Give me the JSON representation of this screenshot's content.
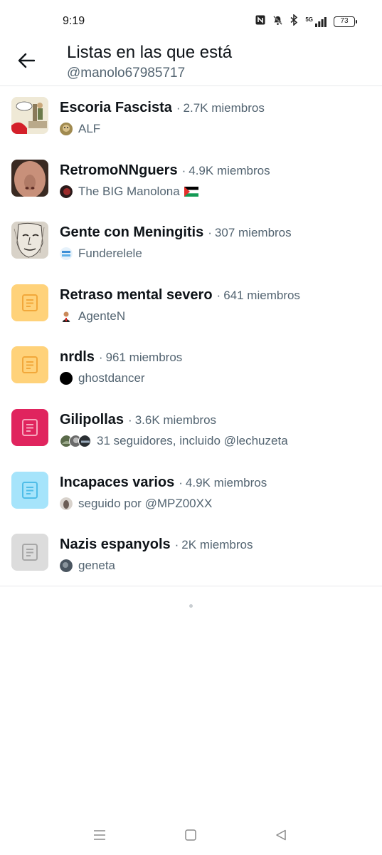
{
  "status_bar": {
    "time": "9:19",
    "network_label": "5G",
    "battery_level": "73"
  },
  "header": {
    "title": "Listas en las que está",
    "subtitle": "@manolo67985717"
  },
  "lists": [
    {
      "name": "Escoria Fascista",
      "members": "2.7K miembros",
      "owner": "ALF",
      "thumb_icon": "cartoon-image",
      "avatar_color": "#a08a50"
    },
    {
      "name": "RetromoNNguers",
      "members": "4.9K miembros",
      "owner": "The BIG Manolona",
      "thumb_icon": "face-photo",
      "avatar_color": "#7a1e1e"
    },
    {
      "name": "Gente con Meningitis",
      "members": "307 miembros",
      "owner": "Funderelele",
      "thumb_icon": "sketch-portrait",
      "avatar_color": "#3d8fd6"
    },
    {
      "name": "Retraso mental severo",
      "members": "641 miembros",
      "owner": "AgenteN",
      "thumb_icon": "list-icon",
      "thumb_color": "#ffd27a",
      "icon_color": "#f2a83a",
      "avatar_color": "#c98a5a"
    },
    {
      "name": "nrdls",
      "members": "961 miembros",
      "owner": "ghostdancer",
      "thumb_icon": "list-icon",
      "thumb_color": "#ffd27a",
      "icon_color": "#f2a83a",
      "avatar_color": "#000000"
    },
    {
      "name": "Gilipollas",
      "members": "3.6K miembros",
      "owner": "31 seguidores, incluido @lechuzeta",
      "thumb_icon": "list-icon",
      "thumb_color": "#e0245e",
      "icon_color": "#f7a6bd",
      "avatar_color": "#5a6a4a"
    },
    {
      "name": "Incapaces varios",
      "members": "4.9K miembros",
      "owner": "seguido por @MPZ00XX",
      "thumb_icon": "list-icon",
      "thumb_color": "#a6e4fb",
      "icon_color": "#4fbde8",
      "avatar_color": "#6b5d55"
    },
    {
      "name": "Nazis espanyols",
      "members": "2K miembros",
      "owner": "geneta",
      "thumb_icon": "list-icon",
      "thumb_color": "#dcdcdc",
      "icon_color": "#a7a7a7",
      "avatar_color": "#4a5560"
    }
  ],
  "separator": "·"
}
